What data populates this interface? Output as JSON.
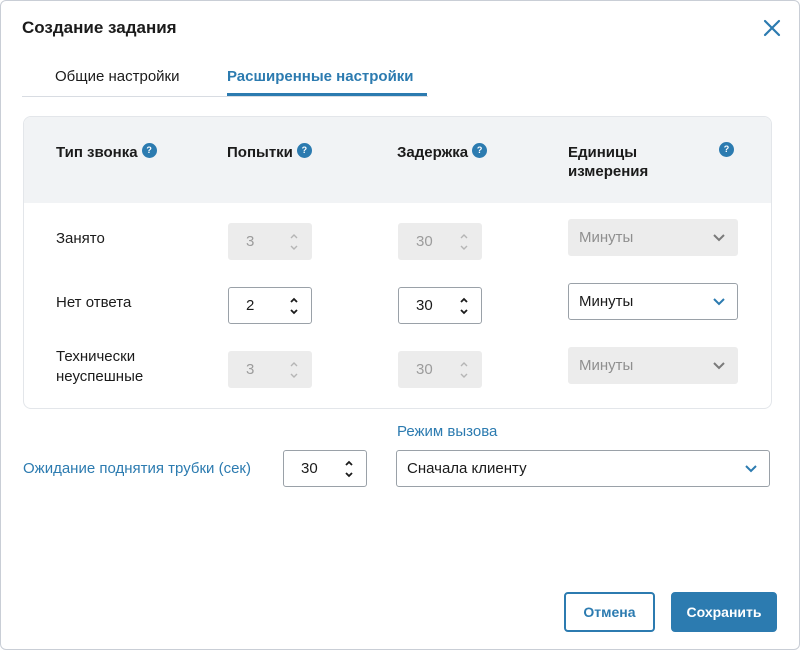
{
  "dialog": {
    "title": "Создание задания"
  },
  "tabs": [
    {
      "label": "Общие настройки",
      "active": false
    },
    {
      "label": "Расширенные настройки",
      "active": true
    }
  ],
  "table": {
    "headers": {
      "call_type": "Тип звонка",
      "attempts": "Попытки",
      "delay": "Задержка",
      "units_line1": "Единицы",
      "units_line2": "измерения",
      "help_glyph": "?"
    },
    "rows": [
      {
        "label": "Занято",
        "attempts": "3",
        "delay": "30",
        "unit": "Минуты",
        "enabled": false
      },
      {
        "label": "Нет ответа",
        "attempts": "2",
        "delay": "30",
        "unit": "Минуты",
        "enabled": true
      },
      {
        "label_line1": "Технически",
        "label_line2": "неуспешные",
        "attempts": "3",
        "delay": "30",
        "unit": "Минуты",
        "enabled": false
      }
    ]
  },
  "pickup_wait": {
    "label": "Ожидание поднятия трубки (сек)",
    "value": "30"
  },
  "call_mode": {
    "label": "Режим вызова",
    "value": "Сначала клиенту"
  },
  "buttons": {
    "cancel": "Отмена",
    "save": "Сохранить"
  },
  "colors": {
    "accent": "#2c7bb0",
    "header_bg": "#f1f3f5",
    "disabled_bg": "#ececec"
  },
  "icons": {
    "close": "close-icon",
    "help": "help-icon",
    "chevron": "chevron-down-icon",
    "stepper": "stepper-arrows-icon"
  }
}
